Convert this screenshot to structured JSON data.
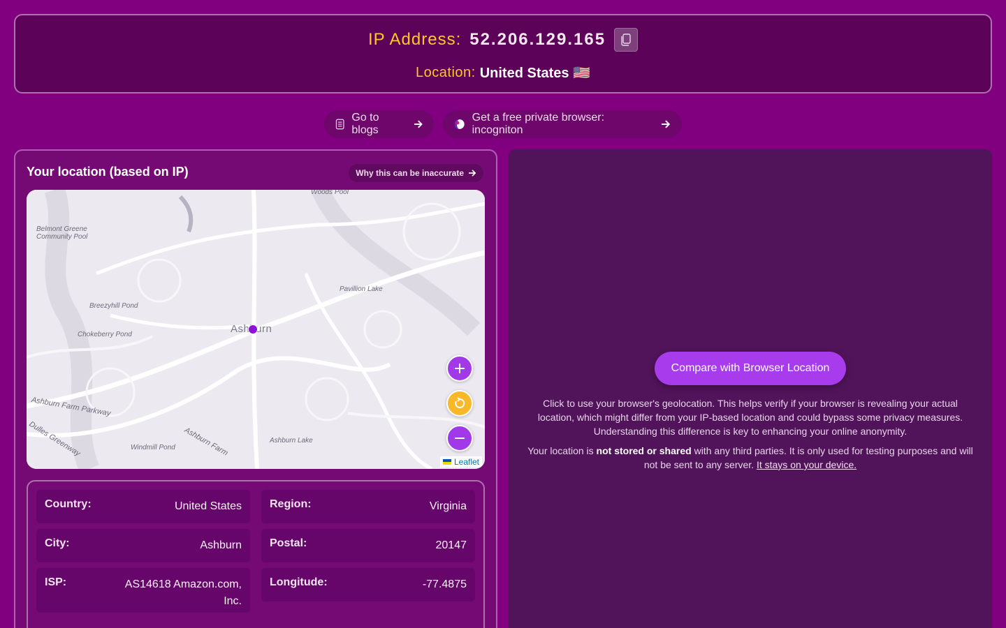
{
  "header": {
    "ip_label": "IP Address:",
    "ip_value": "52.206.129.165",
    "location_label": "Location:",
    "location_value": "United States 🇺🇸"
  },
  "nav": {
    "blogs_label": "Go to blogs",
    "browser_label": "Get a free private browser: incogniton"
  },
  "left_panel": {
    "title": "Your location (based on IP)",
    "why_label": "Why this can be inaccurate",
    "map": {
      "city_label": "Ashburn",
      "place_labels": [
        "Woods Pool",
        "Belmont Greene",
        "Community Pool",
        "Pavillion Lake",
        "Breezyhill Pond",
        "Chokeberry Pond",
        "Ashburn Farm Parkway",
        "Dulles Greenway",
        "Windmill Pond",
        "Ashburn Farm",
        "Ashburn Lake"
      ],
      "attribution": "Leaflet",
      "controls": [
        "zoom-in",
        "reset",
        "zoom-out"
      ]
    },
    "info": {
      "country_label": "Country:",
      "country_value": "United States",
      "region_label": "Region:",
      "region_value": "Virginia",
      "city_label": "City:",
      "city_value": "Ashburn",
      "postal_label": "Postal:",
      "postal_value": "20147",
      "isp_label": "ISP:",
      "isp_value": "AS14618 Amazon.com, Inc.",
      "longitude_label": "Longitude:",
      "longitude_value": "-77.4875"
    }
  },
  "right_panel": {
    "compare_button": "Compare with Browser Location",
    "description": "Click to use your browser's geolocation. This helps verify if your browser is revealing your actual location, which might differ from your IP-based location and could bypass some privacy measures. Understanding this difference is key to enhancing your online anonymity.",
    "privacy_prefix": "Your location is",
    "privacy_bold": "not stored or shared",
    "privacy_middle": "with any third parties. It is only used for testing purposes and will not be sent to any server.",
    "privacy_link": "It stays on your device."
  },
  "colors": {
    "background": "#800080",
    "accent_yellow": "#ffc629",
    "accent_purple": "#a83ced",
    "marker": "#8a12d8"
  }
}
